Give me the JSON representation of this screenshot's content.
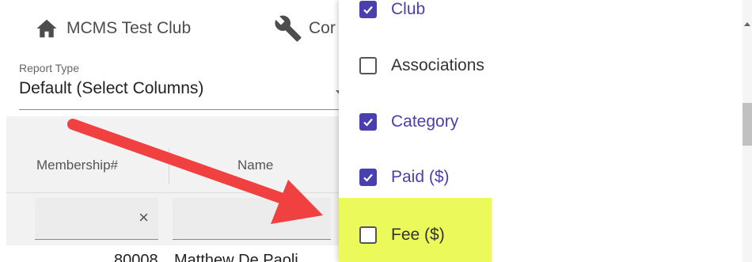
{
  "topbar": {
    "club_label": "MCMS Test Club",
    "tools_label": "Cor"
  },
  "report_type": {
    "label": "Report Type",
    "value": "Default (Select Columns)"
  },
  "table": {
    "headers": [
      "Membership#",
      "Name"
    ],
    "filter_clear_glyph": "×",
    "rows": [
      {
        "membership": "80008",
        "name": "Matthew De Paoli"
      }
    ]
  },
  "column_options": [
    {
      "label": "Club",
      "checked": true
    },
    {
      "label": "Associations",
      "checked": false
    },
    {
      "label": "Category",
      "checked": true
    },
    {
      "label": "Paid ($)",
      "checked": true
    },
    {
      "label": "Fee ($)",
      "checked": false
    }
  ],
  "colors": {
    "accent": "#4a3fb0",
    "highlight": "#ecf95a",
    "annotation_arrow": "#f04040"
  },
  "icons": {
    "home": "home-icon",
    "tools": "wrench-icon",
    "check": "check-icon",
    "clear": "close-icon"
  }
}
